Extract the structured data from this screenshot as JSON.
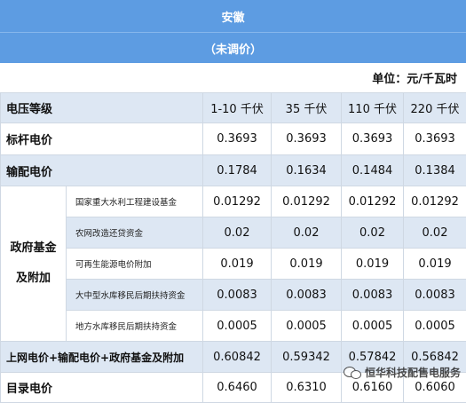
{
  "header": {
    "title": "安徽",
    "subtitle": "（未调价）"
  },
  "unit": "单位：元/千瓦时",
  "table": {
    "label_header": "电压等级",
    "columns": [
      "1-10 千伏",
      "35 千伏",
      "110 千伏",
      "220 千伏"
    ],
    "benchmark": {
      "label": "标杆电价",
      "values": [
        "0.3693",
        "0.3693",
        "0.3693",
        "0.3693"
      ]
    },
    "transmission": {
      "label": "输配电价",
      "values": [
        "0.1784",
        "0.1634",
        "0.1484",
        "0.1384"
      ]
    },
    "gov_fund": {
      "label_line1": "政府基金",
      "label_line2": "及附加",
      "items": [
        {
          "label": "国家重大水利工程建设基金",
          "values": [
            "0.01292",
            "0.01292",
            "0.01292",
            "0.01292"
          ]
        },
        {
          "label": "农网改造还贷资金",
          "values": [
            "0.02",
            "0.02",
            "0.02",
            "0.02"
          ]
        },
        {
          "label": "可再生能源电价附加",
          "values": [
            "0.019",
            "0.019",
            "0.019",
            "0.019"
          ]
        },
        {
          "label": "大中型水库移民后期扶持资金",
          "values": [
            "0.0083",
            "0.0083",
            "0.0083",
            "0.0083"
          ]
        },
        {
          "label": "地方水库移民后期扶持资金",
          "values": [
            "0.0005",
            "0.0005",
            "0.0005",
            "0.0005"
          ]
        }
      ]
    },
    "total": {
      "label": "上网电价+输配电价+政府基金及附加",
      "values": [
        "0.60842",
        "0.59342",
        "0.57842",
        "0.56842"
      ]
    },
    "catalog": {
      "label": "目录电价",
      "values": [
        "0.6460",
        "0.6310",
        "0.6160",
        "0.6060"
      ]
    }
  },
  "watermark": {
    "text": "恒华科技配售电服务",
    "icon": "wechat-icon"
  }
}
